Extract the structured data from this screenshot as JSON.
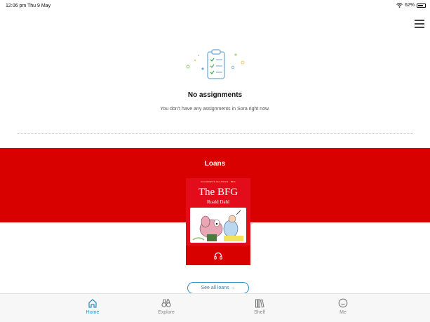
{
  "status_bar": {
    "time": "12:06 pm  Thu 9 May",
    "battery": "62%"
  },
  "assignments": {
    "title": "No assignments",
    "description": "You don't have any assignments in Sora right now."
  },
  "loans": {
    "title": "Loans",
    "book": {
      "title": "The BFG",
      "author": "Roald Dahl",
      "series": "CHILDREN'S CLASSICS · BFG",
      "format": "audiobook"
    },
    "see_all_label": "See all loans →"
  },
  "tabs": [
    {
      "label": "Home",
      "icon": "home-icon",
      "active": true
    },
    {
      "label": "Explore",
      "icon": "binoculars-icon",
      "active": false
    },
    {
      "label": "Shelf",
      "icon": "shelf-icon",
      "active": false
    },
    {
      "label": "Me",
      "icon": "smiley-icon",
      "active": false
    }
  ],
  "colors": {
    "accent": "#2f8fc9",
    "loans_band": "#d90000"
  }
}
